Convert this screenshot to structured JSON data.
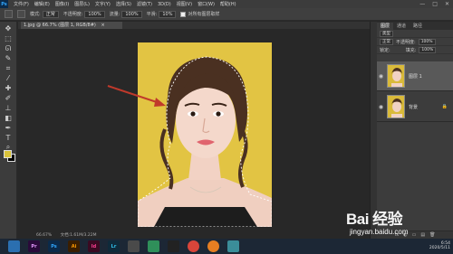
{
  "app": {
    "logo": "Ps"
  },
  "menubar": {
    "items": [
      "文件(F)",
      "编辑(E)",
      "图像(I)",
      "图层(L)",
      "文字(Y)",
      "选择(S)",
      "滤镜(T)",
      "3D(D)",
      "视图(V)",
      "窗口(W)",
      "帮助(H)"
    ],
    "win_min": "—",
    "win_max": "□",
    "win_close": "✕"
  },
  "optbar": {
    "mode_label": "模式:",
    "mode_value": "正常",
    "opacity_label": "不透明度:",
    "opacity_value": "100%",
    "flow_label": "流量:",
    "flow_value": "100%",
    "smooth_label": "平滑:",
    "smooth_value": "10%",
    "sample_all": "对所有图层取样"
  },
  "document": {
    "tab_title": "1.jpg @ 66.7% (图层 1, RGB/8#)",
    "tab_close": "×"
  },
  "status": {
    "zoom": "66.67%",
    "doc_size": "文档:1.61M/3.22M"
  },
  "panels": {
    "tabs": [
      "图层",
      "通道",
      "路径"
    ],
    "filter_label": "类型",
    "blend_mode": "正常",
    "opacity_label": "不透明度:",
    "opacity_value": "100%",
    "lock_label": "锁定:",
    "fill_label": "填充:",
    "fill_value": "100%",
    "layers": [
      {
        "name": "图层 1",
        "selected": true
      },
      {
        "name": "背景",
        "selected": false
      }
    ],
    "lock_icon": "🔒",
    "bottom_icons": [
      "fx",
      "◐",
      "▭",
      "▤",
      "🗑"
    ]
  },
  "taskbar": {
    "icons": [
      {
        "name": "explorer",
        "label": "",
        "color": "#2b6fb0"
      },
      {
        "name": "premiere",
        "label": "Pr",
        "color": "#2a0a3a"
      },
      {
        "name": "photoshop",
        "label": "Ps",
        "color": "#0b2a4a"
      },
      {
        "name": "illustrator",
        "label": "Ai",
        "color": "#3a1e00"
      },
      {
        "name": "indesign",
        "label": "Id",
        "color": "#3a0a22"
      },
      {
        "name": "lightroom",
        "label": "Lr",
        "color": "#0f2a3a"
      },
      {
        "name": "app7",
        "label": "",
        "color": "#4a4a4a"
      },
      {
        "name": "app8",
        "label": "",
        "color": "#2f8f5a"
      },
      {
        "name": "qq",
        "label": "",
        "color": "#222"
      },
      {
        "name": "chrome",
        "label": "",
        "color": "#d9453a"
      },
      {
        "name": "app11",
        "label": "",
        "color": "#e67e22"
      },
      {
        "name": "app12",
        "label": "",
        "color": "#3b8d99"
      }
    ],
    "time": "6:54",
    "date": "2020/5/11"
  },
  "watermark": {
    "logo": "Bai 经验",
    "url": "jingyan.baidu.com"
  },
  "colors": {
    "canvas_bg": "#e2c443",
    "fg": "#d8c23a",
    "bg": "#000000",
    "arrow": "#c0392b"
  }
}
